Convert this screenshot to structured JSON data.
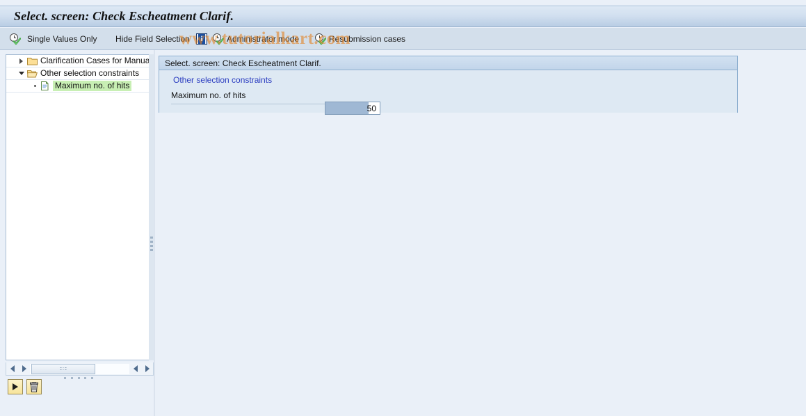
{
  "window": {
    "title": "Select. screen: Check Escheatment Clarif."
  },
  "watermark": {
    "text": "www.tutorialkart.com",
    "color": "#e28428"
  },
  "toolbar": {
    "items": [
      {
        "label": "Single Values Only",
        "icon": "clock-check-icon",
        "has_icon": true
      },
      {
        "label": "Hide Field Selection",
        "icon": "none",
        "has_icon": false
      },
      {
        "label": "",
        "icon": "info-icon",
        "has_icon": true
      },
      {
        "label": "Administrator mode",
        "icon": "clock-check-icon",
        "has_icon": true
      },
      {
        "label": "Resubmission cases",
        "icon": "clock-check-icon",
        "has_icon": true
      }
    ]
  },
  "tree": {
    "rows": [
      {
        "label": "Clarification Cases for Manual E",
        "depth": 0,
        "twisty": "collapsed",
        "icon": "folder-closed-icon",
        "selected": false
      },
      {
        "label": "Other selection constraints",
        "depth": 0,
        "twisty": "expanded",
        "icon": "folder-open-icon",
        "selected": false
      },
      {
        "label": "Maximum no. of hits",
        "depth": 1,
        "twisty": "leaf",
        "icon": "document-icon",
        "selected": true
      }
    ],
    "selection_color": "#c8efb4"
  },
  "tree_footer": {
    "scrollbar": {
      "left_arrow": "left-arrow-icon",
      "right_arrow": "right-arrow-icon",
      "page_left_arrow": "left-arrow-icon",
      "page_right_arrow": "right-arrow-icon"
    },
    "buttons": [
      {
        "name": "execute-button",
        "icon": "play-triangle-icon",
        "label": ""
      },
      {
        "name": "delete-button",
        "icon": "trash-icon",
        "label": ""
      }
    ]
  },
  "content": {
    "header_title": "Select. screen: Check Escheatment Clarif.",
    "group_title": "Other selection constraints",
    "group_title_color": "#2a3cc0",
    "fields": [
      {
        "label": "Maximum no. of hits",
        "value": "50",
        "placeholder": ""
      }
    ]
  }
}
